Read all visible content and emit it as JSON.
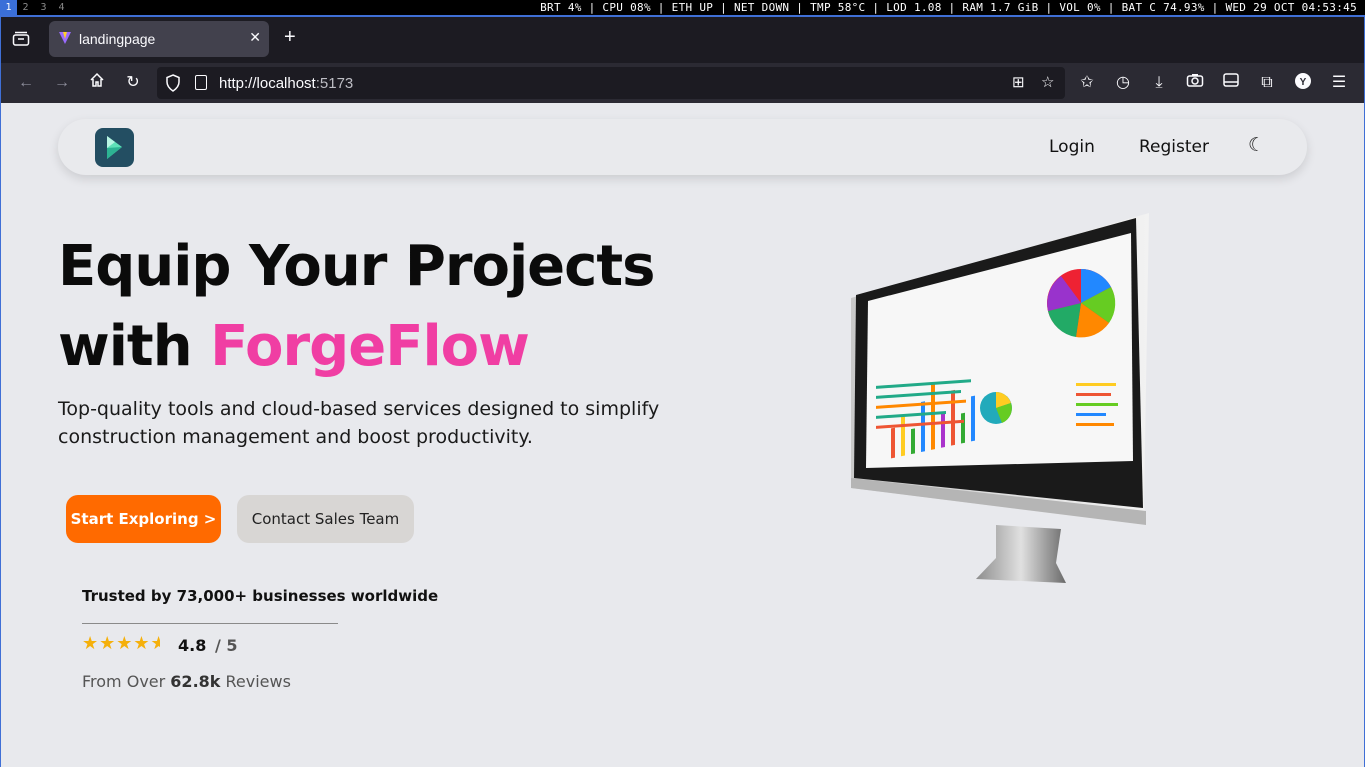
{
  "statusbar": {
    "workspaces": [
      "1",
      "2",
      "3",
      "4"
    ],
    "active_workspace": "1",
    "info": "BRT 4% | CPU 08% | ETH UP | NET DOWN | TMP 58°C | LOD 1.08 | RAM 1.7 GiB | VOL 0% | BAT C 74.93% | WED 29 OCT 04:53:45"
  },
  "browser": {
    "tab_title": "landingpage",
    "url_host": "http://localhost",
    "url_port": ":5173"
  },
  "site": {
    "nav": {
      "login": "Login",
      "register": "Register",
      "theme_icon": "☾"
    },
    "hero": {
      "title_line1": "Equip Your Projects",
      "title_with": "with ",
      "title_brand": "ForgeFlow",
      "subtitle": "Top-quality tools and cloud-based services designed to simplify construction management and boost productivity.",
      "primary_button": "Start Exploring >",
      "secondary_button": "Contact Sales Team"
    },
    "trust": {
      "headline": "Trusted by 73,000+ businesses worldwide",
      "rating": "4.8",
      "rating_max": "/ 5",
      "stars": "★★★★",
      "reviews_prefix": "From Over ",
      "reviews_count": "62.8k",
      "reviews_suffix": " Reviews"
    }
  },
  "colors": {
    "accent": "#f03ea3",
    "primary_button": "#ff6a00",
    "star": "#f5b00b"
  }
}
